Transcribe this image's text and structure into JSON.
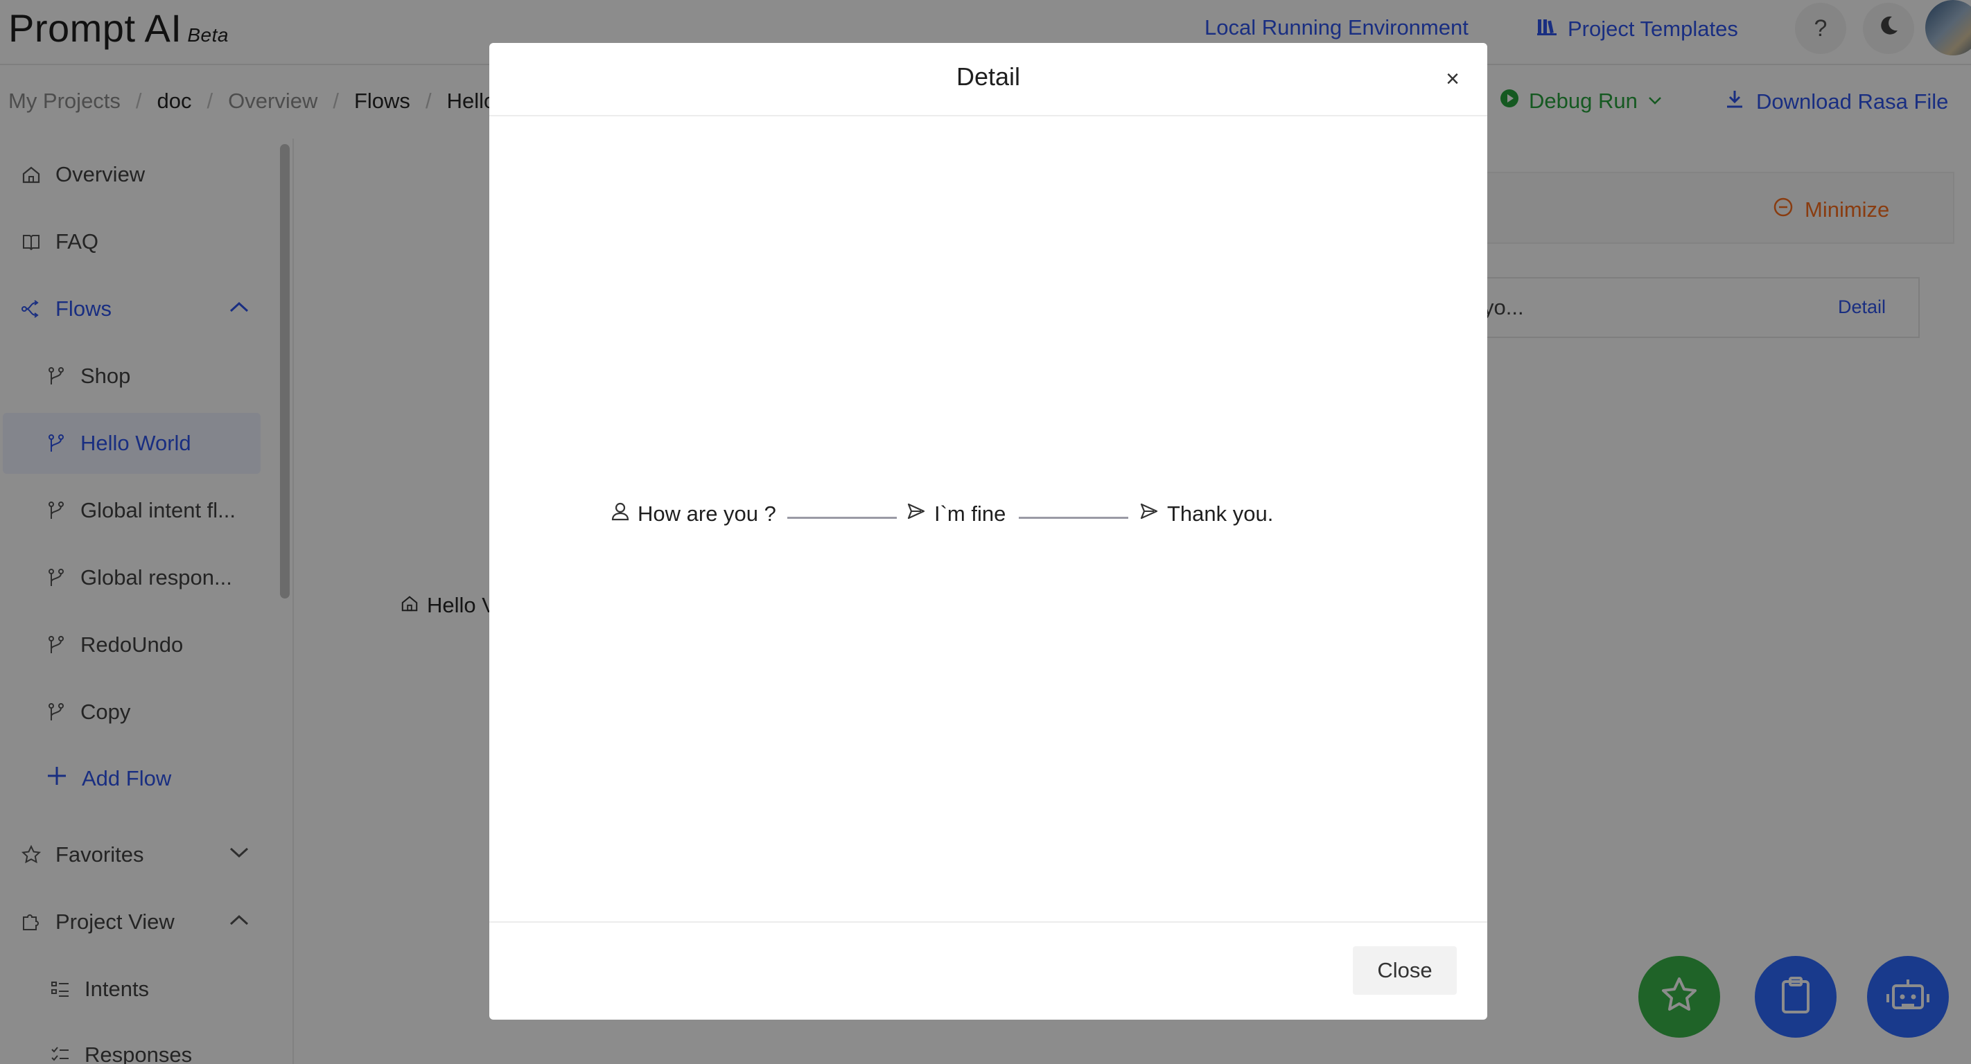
{
  "app": {
    "logo": "Prompt AI",
    "logo_badge": "Beta",
    "header": {
      "env_link": "Local Running Environment",
      "templates_link": "Project Templates",
      "help_symbol": "?",
      "theme_icon": "moon-icon"
    }
  },
  "breadcrumb": [
    "My Projects",
    "doc",
    "Overview",
    "Flows",
    "Hello"
  ],
  "toolbar": {
    "debug_run": "Debug Run",
    "download": "Download Rasa File"
  },
  "sidebar": {
    "items": [
      {
        "label": "Overview",
        "icon": "home-icon"
      },
      {
        "label": "FAQ",
        "icon": "book-icon"
      },
      {
        "label": "Flows",
        "icon": "flow-icon"
      },
      {
        "label": "Favorites",
        "icon": "star-icon"
      },
      {
        "label": "Project View",
        "icon": "puzzle-icon"
      }
    ],
    "flows": [
      "Shop",
      "Hello World",
      "Global intent fl...",
      "Global respon...",
      "RedoUndo",
      "Copy"
    ],
    "add_flow": "Add Flow",
    "project_view_items": [
      "Intents",
      "Responses"
    ]
  },
  "panel": {
    "minimize": "Minimize",
    "row_text": "yo...",
    "row_detail": "Detail"
  },
  "canvas": {
    "node_label": "Hello V"
  },
  "modal": {
    "title": "Detail",
    "close_symbol": "×",
    "close_button": "Close",
    "flow_steps": [
      {
        "label": "How are you ?",
        "icon": "user-icon"
      },
      {
        "label": "I`m fine",
        "icon": "send-icon"
      },
      {
        "label": "Thank you.",
        "icon": "send-icon"
      }
    ]
  },
  "colors": {
    "accent": "#2f54eb",
    "run_green": "#27a33d",
    "minimize_orange": "#fa6e1e",
    "fab_green": "#3ab54a",
    "fab_blue": "#2f6bff"
  }
}
